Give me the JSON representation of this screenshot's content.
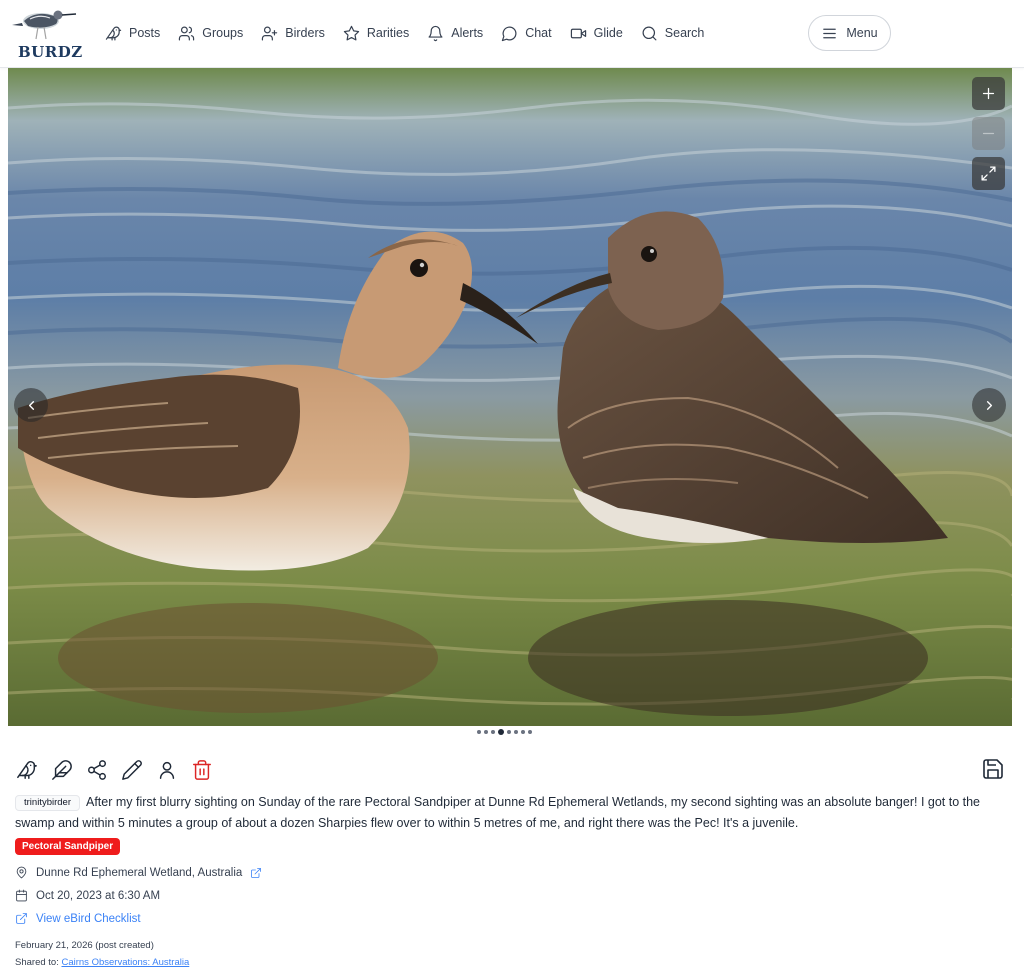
{
  "app": {
    "logo_text": "BURDZ"
  },
  "nav": {
    "items": [
      {
        "label": "Posts",
        "icon": "bird-icon"
      },
      {
        "label": "Groups",
        "icon": "users-icon"
      },
      {
        "label": "Birders",
        "icon": "user-plus-icon"
      },
      {
        "label": "Rarities",
        "icon": "star-icon"
      },
      {
        "label": "Alerts",
        "icon": "bell-icon"
      },
      {
        "label": "Chat",
        "icon": "chat-bubble-icon"
      },
      {
        "label": "Glide",
        "icon": "video-icon"
      },
      {
        "label": "Search",
        "icon": "search-icon"
      }
    ],
    "menu_label": "Menu"
  },
  "gallery": {
    "image_count": 8,
    "active_index": 3,
    "controls": [
      "zoom-in-icon",
      "zoom-out-icon",
      "fullscreen-icon"
    ]
  },
  "actions": {
    "icons": [
      "bird-icon",
      "feather-icon",
      "share-icon",
      "pencil-icon",
      "user-icon",
      "trash-icon"
    ],
    "save_icon": "save-icon"
  },
  "post": {
    "username": "trinitybirder",
    "text": "After my first blurry sighting on Sunday of the rare Pectoral Sandpiper at Dunne Rd Ephemeral Wetlands, my second sighting was an absolute banger! I got to the swamp and within 5 minutes a group of about a dozen Sharpies flew over to within 5 metres of me, and right there was the Pec! It's a juvenile.",
    "species_tag": "Pectoral Sandpiper",
    "location": "Dunne Rd Ephemeral Wetland, Australia",
    "datetime": "Oct 20, 2023 at 6:30 AM",
    "ebird_link": "View eBird Checklist",
    "created": "February 21, 2026 (post created)",
    "shared_prefix": "Shared to: ",
    "shared_group": "Cairns Observations: Australia"
  },
  "colors": {
    "accent": "#3b82f6",
    "species_tag_bg": "#ef1c1c",
    "delete": "#dc2626",
    "text": "#1f2937"
  }
}
